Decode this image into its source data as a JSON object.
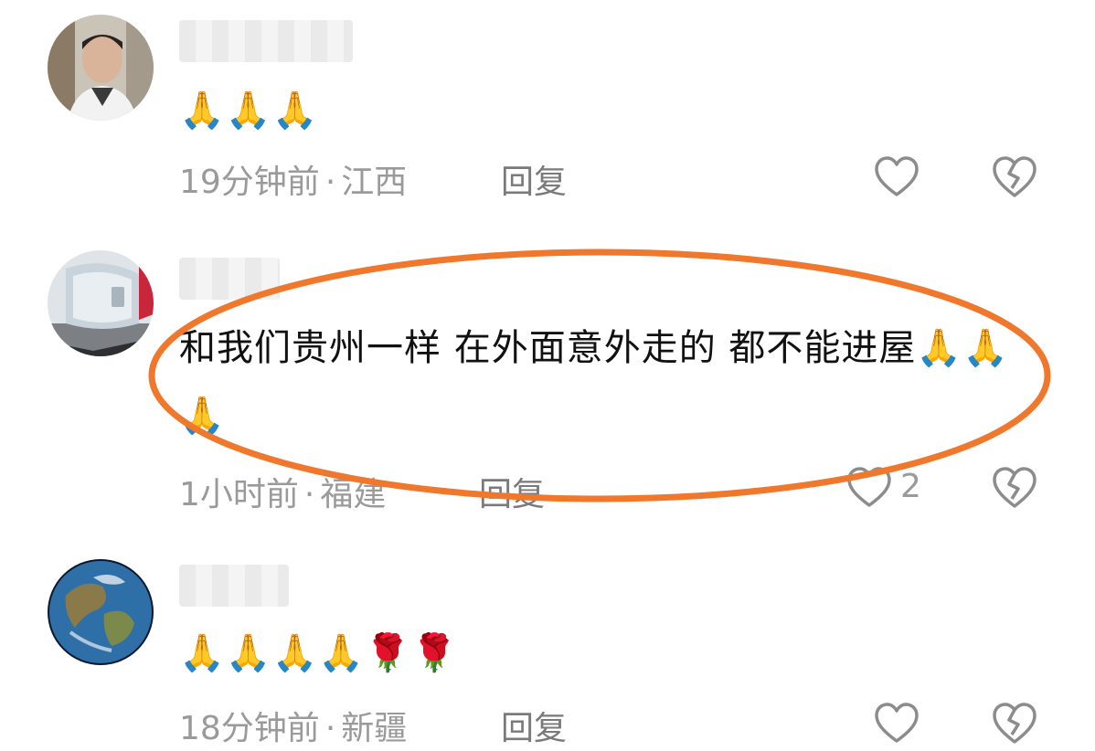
{
  "comments": [
    {
      "username": "",
      "text": "🙏🙏🙏",
      "time": "19分钟前",
      "location": "江西",
      "reply_label": "回复",
      "like_count": "",
      "avatar_icon": "person-photo-avatar"
    },
    {
      "username": "",
      "text": "和我们贵州一样 在外面意外走的 都不能进屋🙏🙏🙏",
      "time": "1小时前",
      "location": "福建",
      "reply_label": "回复",
      "like_count": "2",
      "avatar_icon": "car-mirror-avatar",
      "highlighted": true,
      "highlight_color": "#F0782D"
    },
    {
      "username": "",
      "text": "🙏🙏🙏🙏🌹🌹",
      "time": "18分钟前",
      "location": "新疆",
      "reply_label": "回复",
      "like_count": "",
      "avatar_icon": "earth-globe-avatar"
    }
  ],
  "meta_separator": "·",
  "icons": {
    "like": "heart-outline-icon",
    "dislike": "broken-heart-icon"
  },
  "colors": {
    "text": "#111111",
    "meta": "#9a9a9a",
    "highlight": "#F0782D"
  }
}
